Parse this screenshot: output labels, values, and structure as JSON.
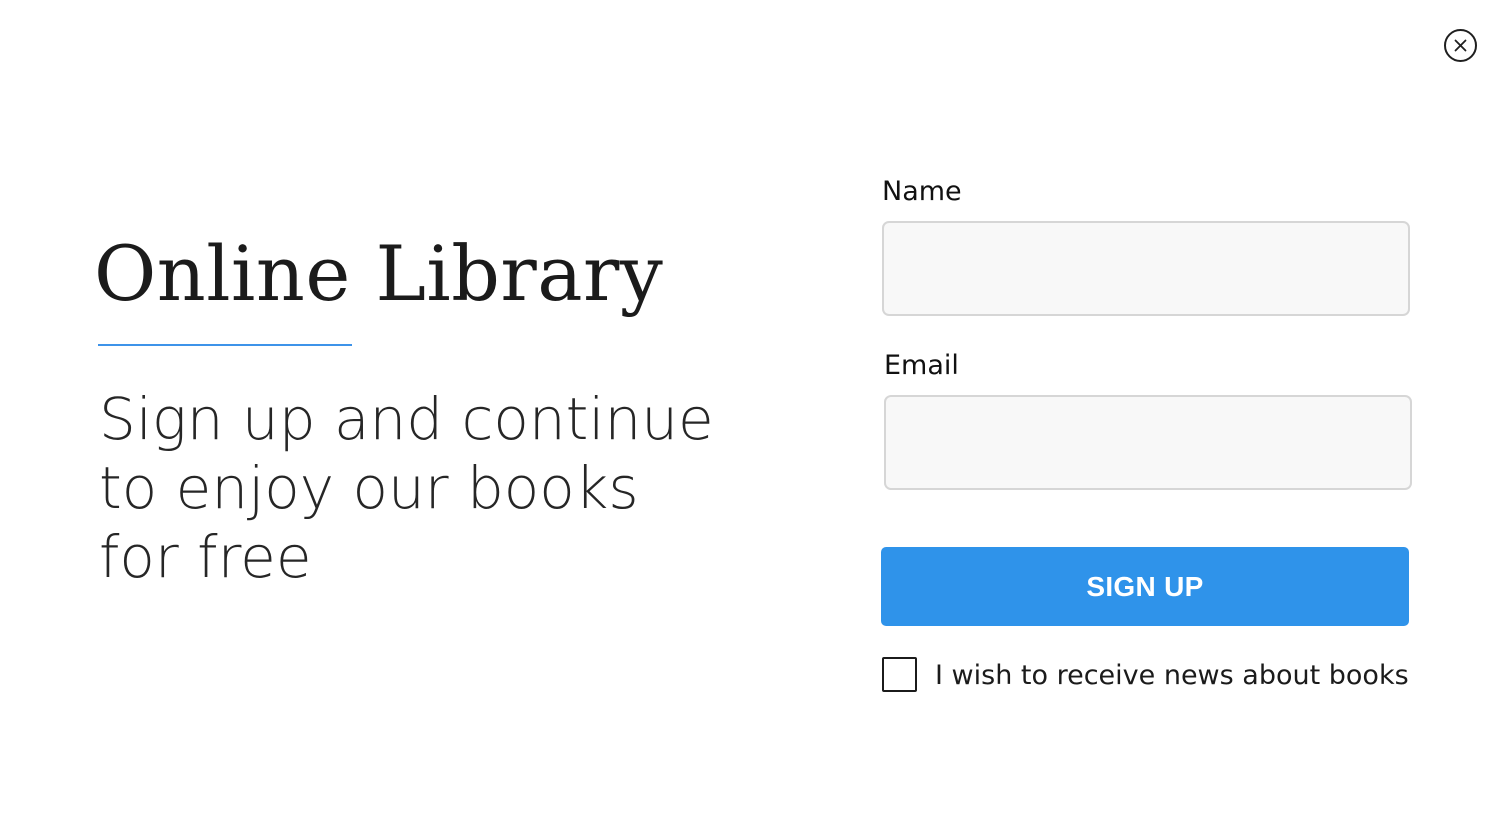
{
  "dialog": {
    "close_icon": "close-icon"
  },
  "branding": {
    "title": "Online Library",
    "tagline_lines": [
      "Sign up and continue",
      "to enjoy our books",
      "for free"
    ]
  },
  "form": {
    "name_label": "Name",
    "name_value": "",
    "email_label": "Email",
    "email_value": "",
    "submit_label": "SIGN UP",
    "newsletter_label": "I wish to receive news about books",
    "newsletter_checked": false
  },
  "colors": {
    "accent": "#2f93ea",
    "divider": "#3d93e9",
    "input_background": "#f8f8f8",
    "input_border": "#d6d6d6"
  }
}
